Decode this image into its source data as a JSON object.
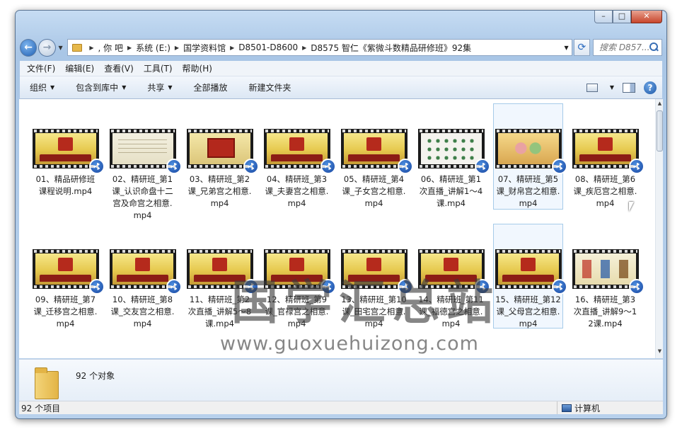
{
  "window": {
    "caption": {
      "minimize": "–",
      "maximize": "□",
      "close": "✕"
    }
  },
  "address": {
    "crumbs": [
      ",  你   吧",
      "系统 (E:)",
      "国学资料馆",
      "D8501-D8600",
      "D8575 智仁《紫微斗数精品研修班》92集"
    ],
    "search_placeholder": "搜索 D857..."
  },
  "menu": [
    "文件(F)",
    "编辑(E)",
    "查看(V)",
    "工具(T)",
    "帮助(H)"
  ],
  "commands": [
    {
      "label": "组织",
      "dropdown": true
    },
    {
      "label": "包含到库中",
      "dropdown": true
    },
    {
      "label": "共享",
      "dropdown": true
    },
    {
      "label": "全部播放",
      "dropdown": false
    },
    {
      "label": "新建文件夹",
      "dropdown": false
    }
  ],
  "files": [
    {
      "name": "01、精品研修班课程说明.mp4",
      "thumb": "gold"
    },
    {
      "name": "02、精研班_第1课_认识命盘十二宫及命宫之相意.mp4",
      "thumb": "paper"
    },
    {
      "name": "03、精研班_第2课_兄弟宫之相意.mp4",
      "thumb": "seal"
    },
    {
      "name": "04、精研班_第3课_夫妻宫之相意.mp4",
      "thumb": "gold"
    },
    {
      "name": "05、精研班_第4课_子女宫之相意.mp4",
      "thumb": "gold"
    },
    {
      "name": "06、精研班_第1次直播_讲解1～4课.mp4",
      "thumb": "dots"
    },
    {
      "name": "07、精研班_第5课_财帛宫之相意.mp4",
      "thumb": "people",
      "selected": true
    },
    {
      "name": "08、精研班_第6课_疾厄宫之相意.mp4",
      "thumb": "gold"
    },
    {
      "name": "09、精研班_第7课_迁移宫之相意.mp4",
      "thumb": "gold"
    },
    {
      "name": "10、精研班_第8课_交友宫之相意.mp4",
      "thumb": "gold"
    },
    {
      "name": "11、精研班_第2次直播_讲解5～8课.mp4",
      "thumb": "gold"
    },
    {
      "name": "12、精研班_第9课_官禄宫之相意.mp4",
      "thumb": "gold"
    },
    {
      "name": "13、精研班_第10课_田宅宫之相意.mp4",
      "thumb": "gold"
    },
    {
      "name": "14、精研班_第11课_福德宫之相意.mp4",
      "thumb": "gold"
    },
    {
      "name": "15、精研班_第12课_父母宫之相意.mp4",
      "thumb": "gold",
      "selected": true
    },
    {
      "name": "16、精研班_第3次直播_讲解9～12课.mp4",
      "thumb": "title"
    }
  ],
  "watermark": {
    "text": "国学汇总站",
    "url": "www.guoxuehuizong.com"
  },
  "details": {
    "count": "92 个对象"
  },
  "status": {
    "left": "92 个项目",
    "right": "计算机"
  },
  "colors": {
    "accent": "#1f5fb3",
    "selection": "#a6cbe9"
  }
}
